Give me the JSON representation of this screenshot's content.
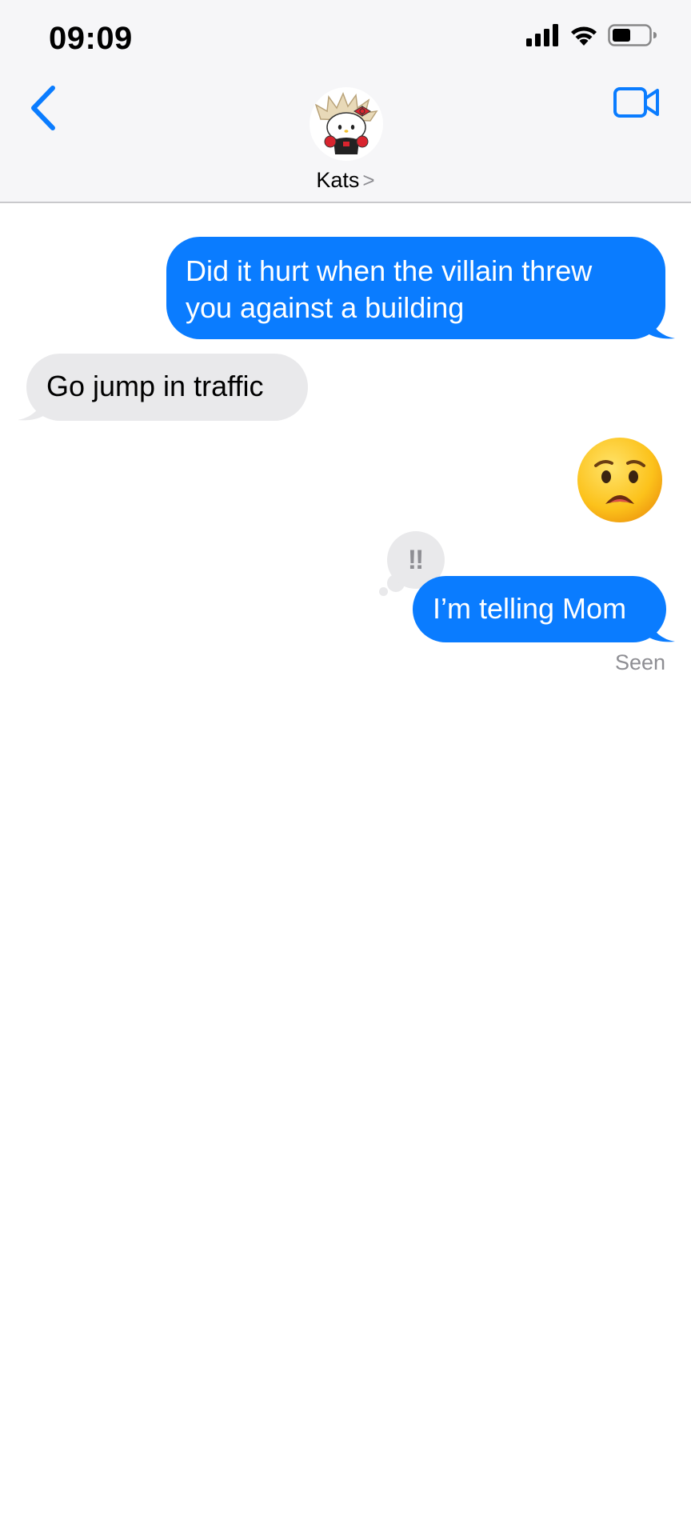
{
  "status_bar": {
    "time": "09:09",
    "icons": [
      "cellular-signal-icon",
      "wifi-icon",
      "battery-icon"
    ]
  },
  "header": {
    "back_icon": "chevron-left-icon",
    "video_icon": "video-camera-icon",
    "contact_name": "Kats",
    "contact_chevron": ">"
  },
  "messages": [
    {
      "direction": "sent",
      "text": "Did it hurt when the villain threw you against a building"
    },
    {
      "direction": "received",
      "text": "Go jump in traffic"
    },
    {
      "direction": "sent",
      "emoji": "anguished-face-emoji"
    },
    {
      "direction": "sent",
      "text": "I’m telling Mom",
      "tapback": "‼"
    }
  ],
  "read_receipt": "Seen",
  "colors": {
    "accent": "#0a7cff",
    "received_bubble": "#e9e9eb",
    "secondary_text": "#8e8e93"
  }
}
